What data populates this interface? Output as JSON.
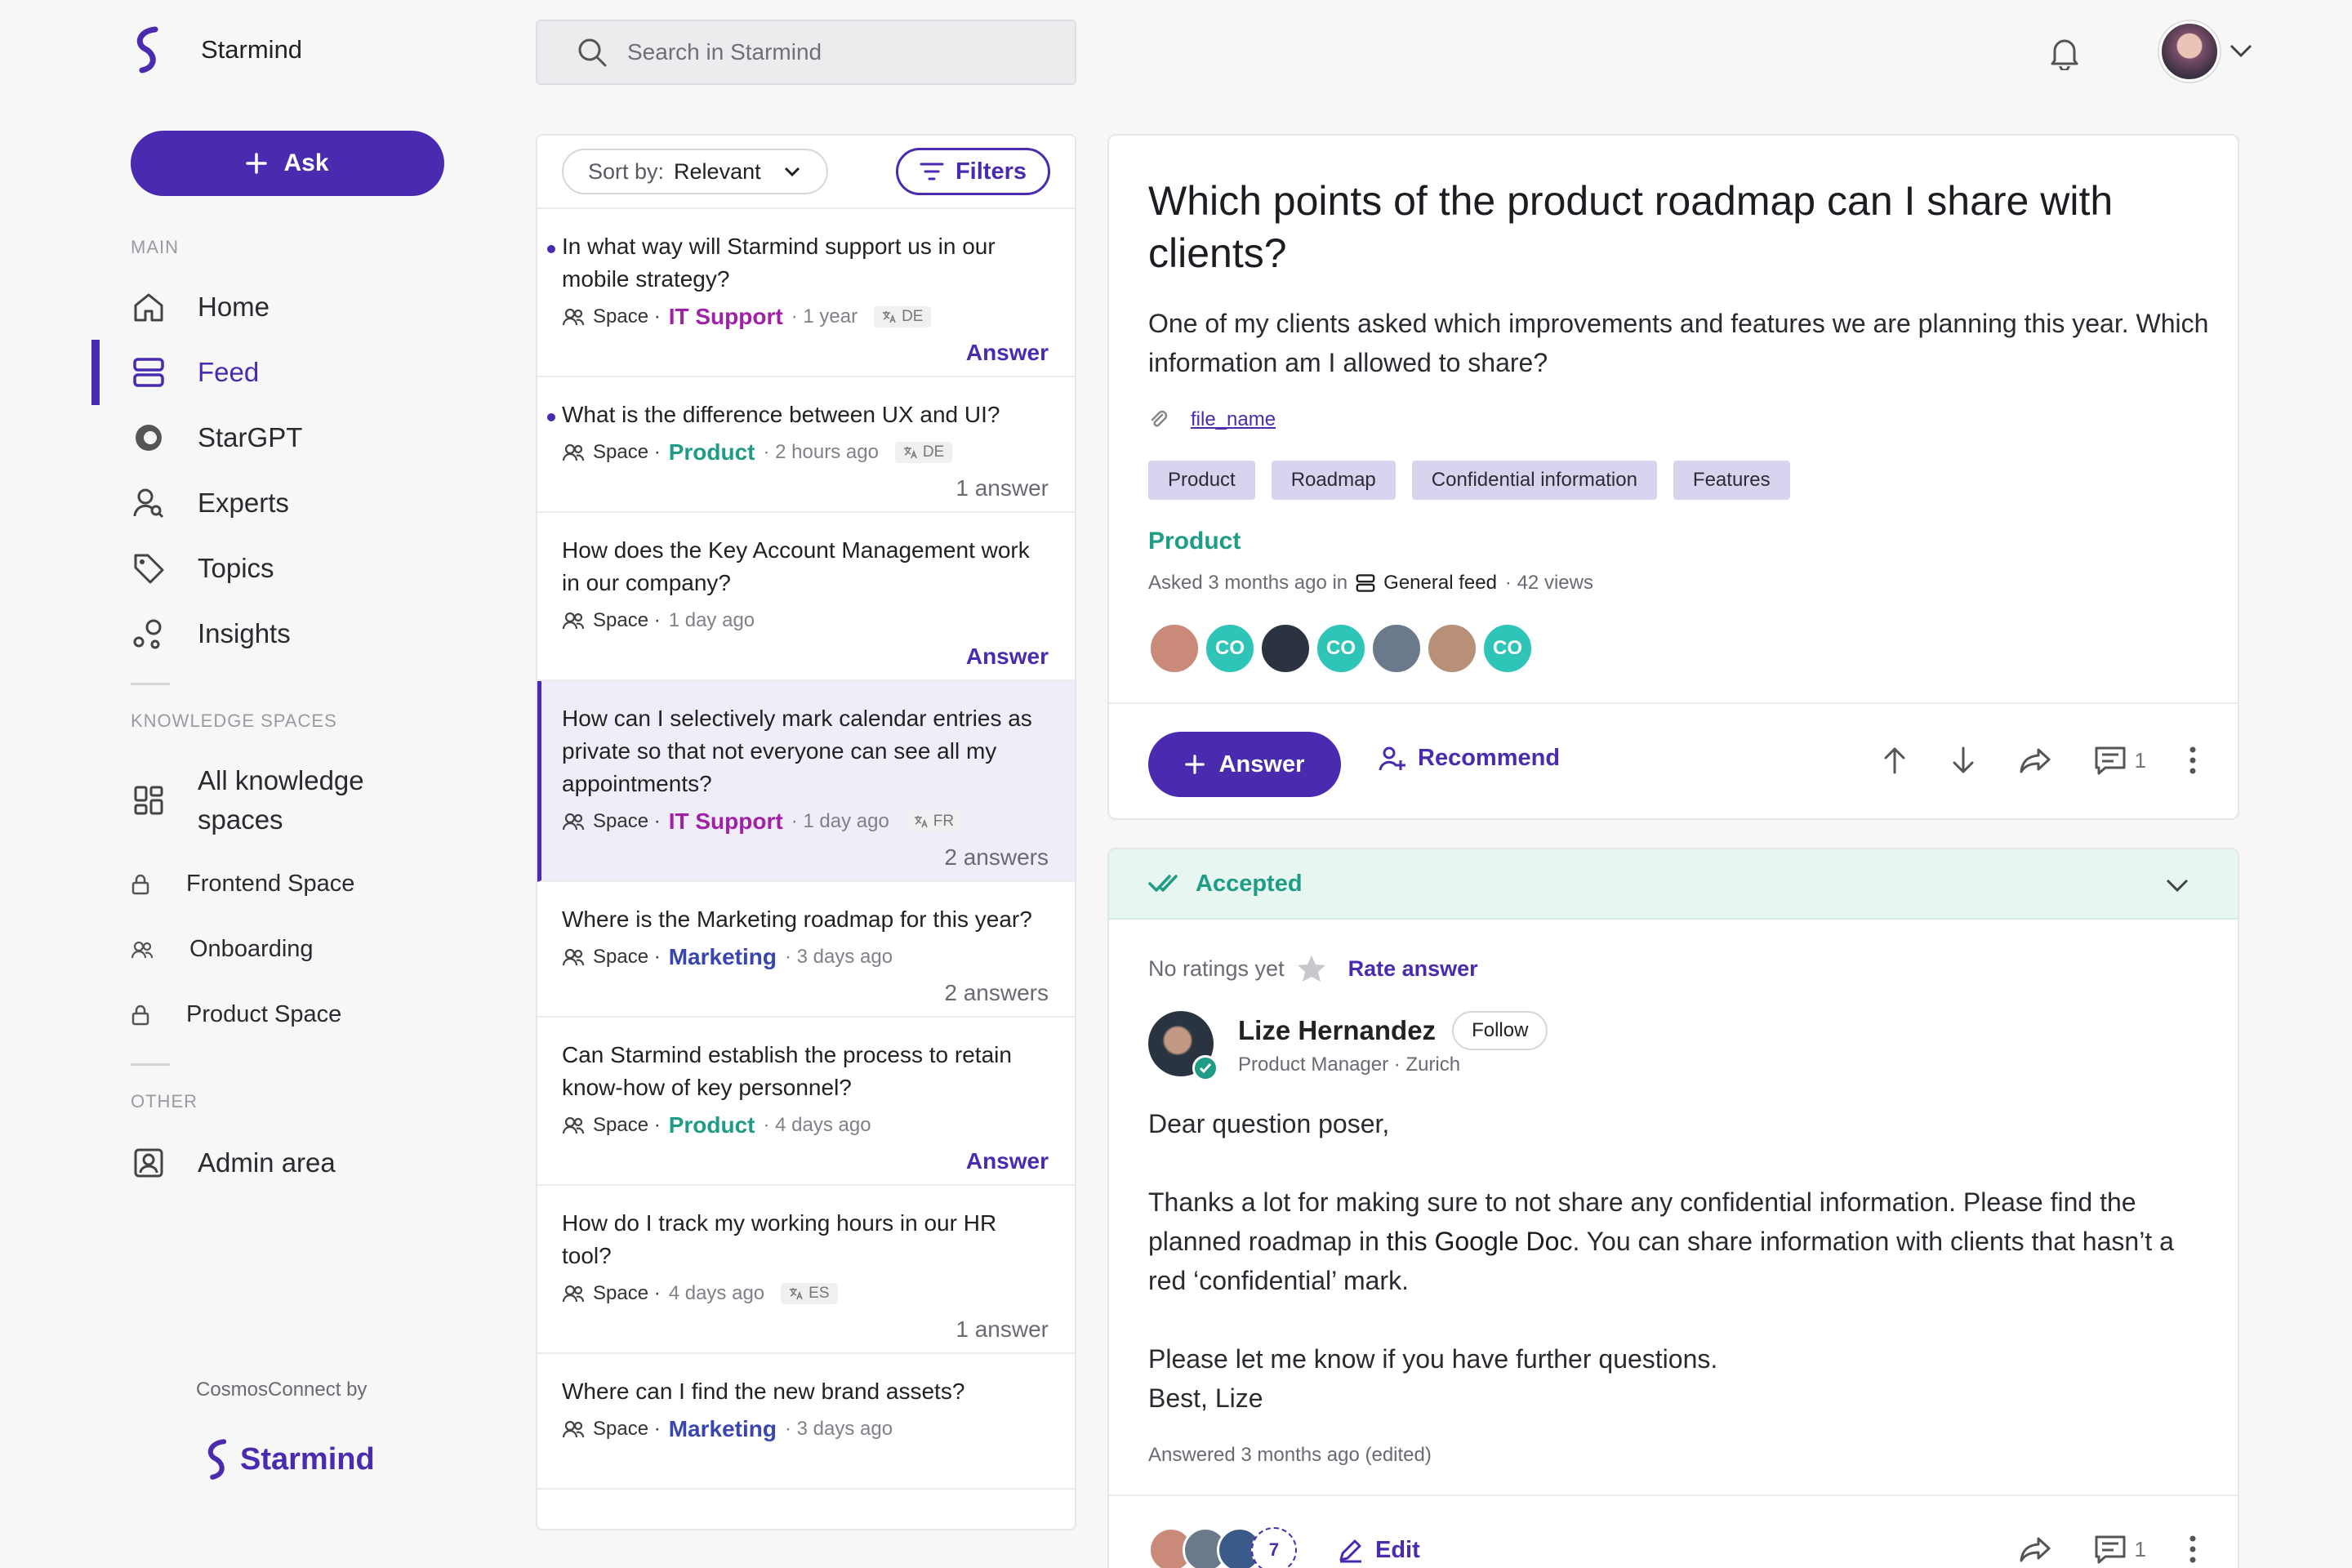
{
  "app": {
    "name": "Starmind",
    "accent": "#4a2bb0",
    "teal": "#1e9c86"
  },
  "search": {
    "placeholder": "Search in Starmind"
  },
  "sidebar": {
    "ask_label": "Ask",
    "main_label": "MAIN",
    "nav": [
      {
        "label": "Home",
        "icon": "home-icon"
      },
      {
        "label": "Feed",
        "icon": "feed-icon",
        "active": true
      },
      {
        "label": "StarGPT",
        "icon": "stargpt-icon"
      },
      {
        "label": "Experts",
        "icon": "experts-icon"
      },
      {
        "label": "Topics",
        "icon": "tag-icon"
      },
      {
        "label": "Insights",
        "icon": "insights-icon"
      }
    ],
    "spaces_label": "KNOWLEDGE SPACES",
    "all_spaces": "All knowledge spaces",
    "spaces": [
      {
        "label": "Frontend Space",
        "icon": "lock-icon"
      },
      {
        "label": "Onboarding",
        "icon": "group-icon"
      },
      {
        "label": "Product Space",
        "icon": "lock-icon"
      }
    ],
    "other_label": "OTHER",
    "admin": "Admin area",
    "footer_by": "CosmosConnect by",
    "footer_brand": "Starmind"
  },
  "feed": {
    "sort_prefix": "Sort by:",
    "sort_value": "Relevant",
    "filters": "Filters",
    "space_word": "Space ·",
    "items": [
      {
        "title": "In what way will Starmind support us in our mobile strategy?",
        "space": "IT Support",
        "space_color": "#a020a8",
        "time": "· 1 year",
        "lang": "DE",
        "right": "Answer",
        "unread": true
      },
      {
        "title": "What is the difference between UX and UI?",
        "space": "Product",
        "space_color": "#1e9c86",
        "time": "· 2 hours ago",
        "lang": "DE",
        "right": "1 answer",
        "unread": true
      },
      {
        "title": "How does the Key Account Management work in our company?",
        "space": "",
        "space_color": "",
        "time": "1 day ago",
        "lang": "",
        "right": "Answer"
      },
      {
        "title": "How can I selectively mark calendar entries as private so that not everyone can see all my appointments?",
        "space": "IT Support",
        "space_color": "#a020a8",
        "time": "· 1 day ago",
        "lang": "FR",
        "right": "2 answers",
        "selected": true
      },
      {
        "title": "Where is the Marketing roadmap for this year?",
        "space": "Marketing",
        "space_color": "#3a46b0",
        "time": "· 3 days ago",
        "lang": "",
        "right": "2 answers"
      },
      {
        "title": "Can Starmind establish the process to retain know-how of key personnel?",
        "space": "Product",
        "space_color": "#1e9c86",
        "time": "· 4 days ago",
        "lang": "",
        "right": "Answer"
      },
      {
        "title": "How do I track my working hours in our HR tool?",
        "space": "",
        "space_color": "",
        "time": "4 days ago",
        "lang": "ES",
        "right": "1 answer"
      },
      {
        "title": "Where can I find the new brand assets?",
        "space": "Marketing",
        "space_color": "#3a46b0",
        "time": "· 3 days ago",
        "lang": "",
        "right": ""
      }
    ]
  },
  "question": {
    "title": "Which points of the product roadmap can I share with clients?",
    "body": "One of my clients asked which improvements and features we are planning this year. Which information am I allowed to share?",
    "file": "file_name",
    "tags": [
      "Product",
      "Roadmap",
      "Confidential information",
      "Features"
    ],
    "space": "Product",
    "asked": "Asked 3 months ago in",
    "feed_name": "General feed",
    "views": "· 42 views",
    "followers": [
      {
        "initials": "",
        "color": "#c98a7a"
      },
      {
        "initials": "CO",
        "color": "#2fc4b8"
      },
      {
        "initials": "",
        "color": "#2b3340"
      },
      {
        "initials": "CO",
        "color": "#2fc4b8"
      },
      {
        "initials": "",
        "color": "#6a7a8a"
      },
      {
        "initials": "",
        "color": "#b89078"
      },
      {
        "initials": "CO",
        "color": "#2fc4b8"
      }
    ],
    "answer_label": "Answer",
    "recommend_label": "Recommend",
    "comment_count": "1"
  },
  "answer": {
    "accepted_label": "Accepted",
    "no_ratings": "No ratings yet",
    "rate_label": "Rate answer",
    "author_name": "Lize Hernandez",
    "follow_label": "Follow",
    "author_role": "Product Manager · Zurich",
    "greeting": "Dear question poser,",
    "para_before_link": "Thanks a lot for making sure to not share any confidential information. Please find the planned roadmap in ",
    "link_text": "this Google Doc",
    "para_after_link": ". You can share information with clients that hasn’t a red ‘confidential’ mark.",
    "closing_1": "Please let me know if you have further questions.",
    "closing_2": "Best, Lize",
    "answered": "Answered 3 months ago (edited)",
    "more_count": "7",
    "edit_label": "Edit",
    "comment_count": "1"
  }
}
